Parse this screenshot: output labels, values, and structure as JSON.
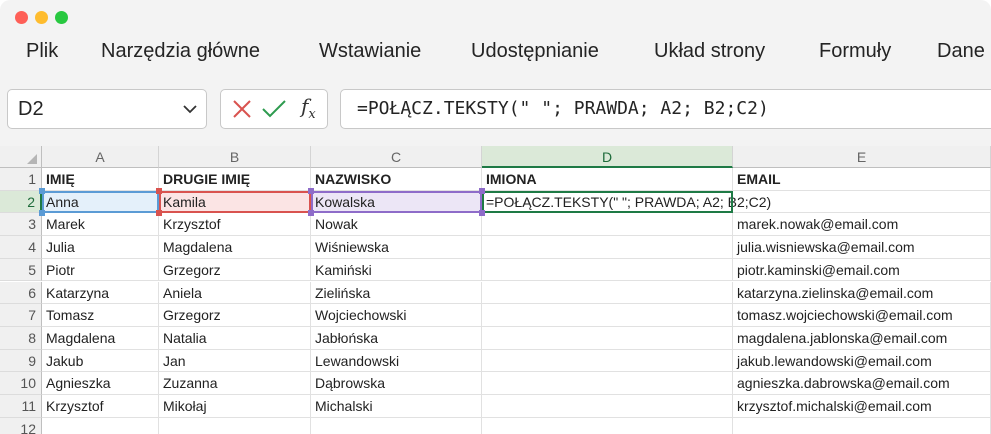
{
  "menu": {
    "items": [
      {
        "id": "plik",
        "label": "Plik"
      },
      {
        "id": "narzedzia",
        "label": "Narzędzia główne"
      },
      {
        "id": "wstawianie",
        "label": "Wstawianie"
      },
      {
        "id": "udostepnianie",
        "label": "Udostępnianie"
      },
      {
        "id": "uklad",
        "label": "Układ strony"
      },
      {
        "id": "formuly",
        "label": "Formuły"
      },
      {
        "id": "dane",
        "label": "Dane"
      }
    ]
  },
  "formula_bar": {
    "name_box": "D2",
    "fx_label": "f",
    "fx_sub": "x",
    "formula": "=POŁĄCZ.TEKSTY(\" \"; PRAWDA; A2; B2;C2)"
  },
  "sheet": {
    "columns": [
      "A",
      "B",
      "C",
      "D",
      "E"
    ],
    "active_column": "D",
    "active_row": "2",
    "rows": [
      {
        "num": "1",
        "cells": [
          "IMIĘ",
          "DRUGIE IMIĘ",
          "NAZWISKO",
          "IMIONA",
          "EMAIL"
        ]
      },
      {
        "num": "2",
        "cells": [
          "Anna",
          "Kamila",
          "Kowalska",
          "=POŁĄCZ.TEKSTY(\" \"; PRAWDA; A2; B2;C2)",
          ""
        ]
      },
      {
        "num": "3",
        "cells": [
          "Marek",
          "Krzysztof",
          "Nowak",
          "",
          "marek.nowak@email.com"
        ]
      },
      {
        "num": "4",
        "cells": [
          "Julia",
          "Magdalena",
          "Wiśniewska",
          "",
          "julia.wisniewska@email.com"
        ]
      },
      {
        "num": "5",
        "cells": [
          "Piotr",
          "Grzegorz",
          "Kamiński",
          "",
          "piotr.kaminski@email.com"
        ]
      },
      {
        "num": "6",
        "cells": [
          "Katarzyna",
          "Aniela",
          "Zielińska",
          "",
          "katarzyna.zielinska@email.com"
        ]
      },
      {
        "num": "7",
        "cells": [
          "Tomasz",
          "Grzegorz",
          "Wojciechowski",
          "",
          "tomasz.wojciechowski@email.com"
        ]
      },
      {
        "num": "8",
        "cells": [
          "Magdalena",
          "Natalia",
          "Jabłońska",
          "",
          "magdalena.jablonska@email.com"
        ]
      },
      {
        "num": "9",
        "cells": [
          "Jakub",
          "Jan",
          "Lewandowski",
          "",
          "jakub.lewandowski@email.com"
        ]
      },
      {
        "num": "10",
        "cells": [
          "Agnieszka",
          "Zuzanna",
          "Dąbrowska",
          "",
          "agnieszka.dabrowska@email.com"
        ]
      },
      {
        "num": "11",
        "cells": [
          "Krzysztof",
          "Mikołaj",
          "Michalski",
          "",
          "krzysztof.michalski@email.com"
        ]
      },
      {
        "num": "12",
        "cells": [
          "",
          "",
          "",
          "",
          ""
        ]
      }
    ]
  },
  "colors": {
    "accent": "#1e7a45",
    "ref_a": "#5b9bd5",
    "ref_b": "#d9534f",
    "ref_c": "#8e6cc9",
    "cancel": "#d9534f",
    "confirm": "#2e9b4f"
  }
}
